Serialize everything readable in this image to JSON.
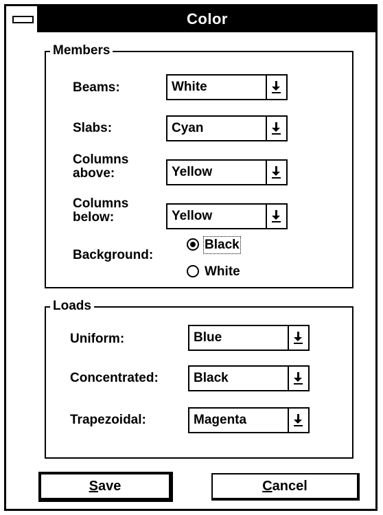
{
  "window": {
    "title": "Color",
    "system_menu_icon": "system-menu-icon"
  },
  "members": {
    "legend": "Members",
    "beams": {
      "label": "Beams:",
      "value": "White"
    },
    "slabs": {
      "label": "Slabs:",
      "value": "Cyan"
    },
    "columns_above": {
      "label_line1": "Columns",
      "label_line2": "above:",
      "value": "Yellow"
    },
    "columns_below": {
      "label_line1": "Columns",
      "label_line2": "below:",
      "value": "Yellow"
    },
    "background": {
      "label": "Background:",
      "options": [
        {
          "label": "Black",
          "selected": true
        },
        {
          "label": "White",
          "selected": false
        }
      ]
    }
  },
  "loads": {
    "legend": "Loads",
    "uniform": {
      "label": "Uniform:",
      "value": "Blue"
    },
    "concentrated": {
      "label": "Concentrated:",
      "value": "Black"
    },
    "trapezoidal": {
      "label": "Trapezoidal:",
      "value": "Magenta"
    }
  },
  "buttons": {
    "save": {
      "underlined_char": "S",
      "rest": "ave"
    },
    "cancel": {
      "underlined_char": "C",
      "rest": "ancel"
    }
  },
  "icons": {
    "dropdown": "dropdown-arrow-icon"
  }
}
